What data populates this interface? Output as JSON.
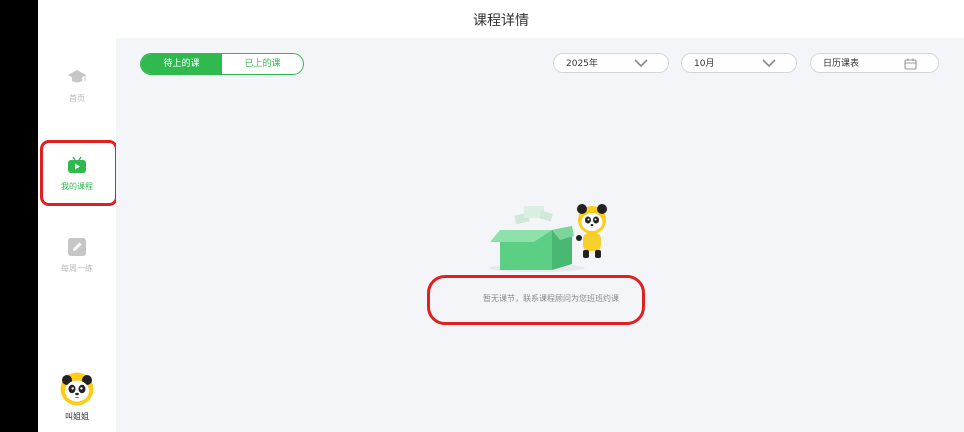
{
  "header": {
    "title": "课程详情"
  },
  "sidebar": {
    "items": [
      {
        "label": "首页",
        "icon": "graduation-cap-icon",
        "active": false
      },
      {
        "label": "我的课程",
        "icon": "tv-play-icon",
        "active": true
      },
      {
        "label": "每周一练",
        "icon": "pencil-icon",
        "active": false
      }
    ],
    "profile": {
      "name": "叫姐姐",
      "avatar": "panda-avatar"
    }
  },
  "tabs": [
    {
      "label": "待上的课",
      "active": true
    },
    {
      "label": "已上的课",
      "active": false
    }
  ],
  "filters": {
    "year": "2025年",
    "month": "10月",
    "calendar": "日历课表"
  },
  "empty_state": {
    "message": "暂无课节，联系课程顾问为您班班约课",
    "illustration": "empty-box-panda"
  },
  "colors": {
    "accent": "#2fb94f",
    "highlight": "#e02020",
    "main_bg": "#f4f5f9"
  }
}
